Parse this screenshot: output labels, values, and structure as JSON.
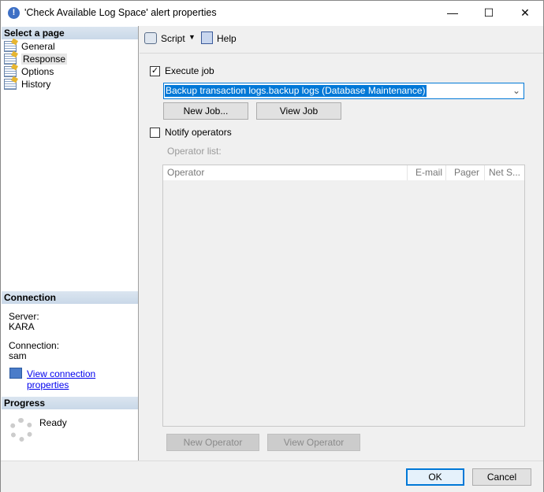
{
  "window": {
    "title": "'Check Available Log Space' alert properties",
    "minimize": "—",
    "maximize": "☐",
    "close": "✕"
  },
  "sidebar": {
    "header": "Select a page",
    "items": [
      {
        "label": "General"
      },
      {
        "label": "Response"
      },
      {
        "label": "Options"
      },
      {
        "label": "History"
      }
    ]
  },
  "connection": {
    "header": "Connection",
    "server_label": "Server:",
    "server": "KARA",
    "connection_label": "Connection:",
    "connection": "sam",
    "link": "View connection properties"
  },
  "progress": {
    "header": "Progress",
    "status": "Ready"
  },
  "toolbar": {
    "script": "Script",
    "help": "Help"
  },
  "response": {
    "execute_job_label": "Execute job",
    "execute_job_checked": true,
    "job_value": "Backup transaction logs.backup logs (Database Maintenance)",
    "new_job": "New Job...",
    "view_job": "View Job",
    "notify_label": "Notify operators",
    "notify_checked": false,
    "operator_list_label": "Operator list:",
    "columns": [
      "Operator",
      "E-mail",
      "Pager",
      "Net S..."
    ],
    "new_operator": "New Operator",
    "view_operator": "View Operator"
  },
  "footer": {
    "ok": "OK",
    "cancel": "Cancel"
  }
}
